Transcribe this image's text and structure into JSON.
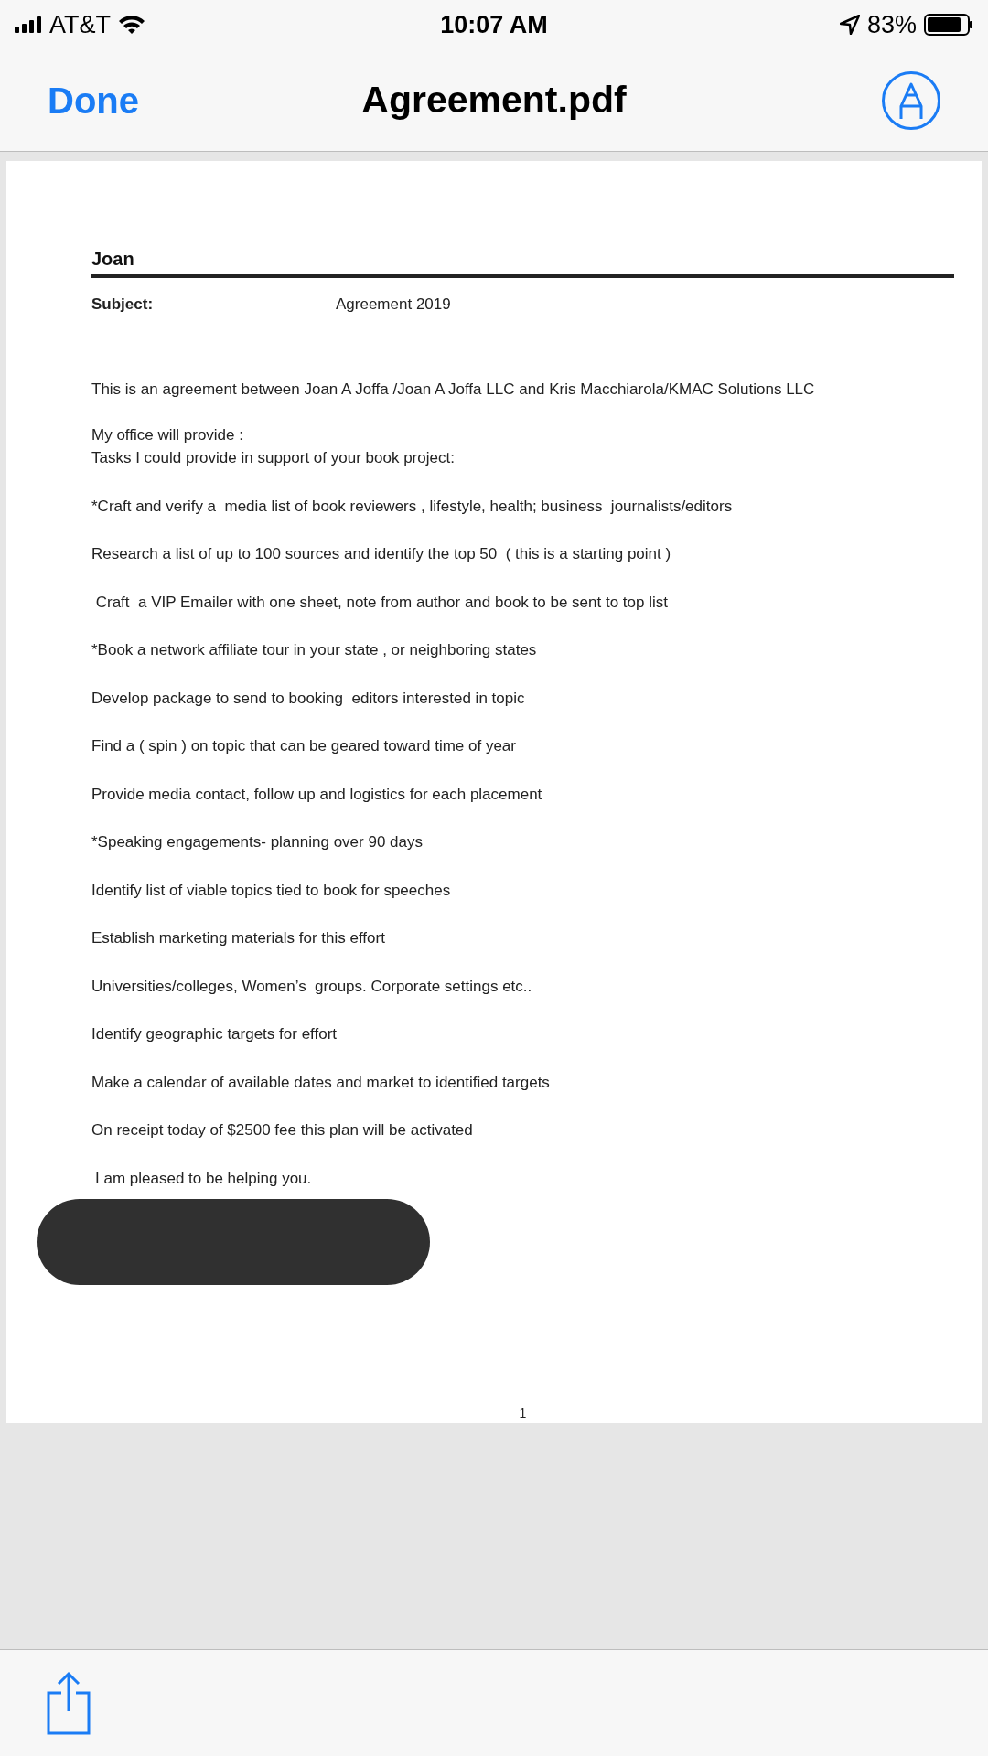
{
  "status_bar": {
    "carrier": "AT&T",
    "time": "10:07 AM",
    "battery": "83%"
  },
  "nav_bar": {
    "done": "Done",
    "title": "Agreement.pdf"
  },
  "document": {
    "header": "Joan",
    "subject_label": "Subject:",
    "subject": "Agreement 2019",
    "intro": "This is an agreement between Joan A Joffa /Joan A Joffa LLC and Kris Macchiarola/KMAC Solutions LLC",
    "provide": [
      "My office will provide :",
      "Tasks I could provide in support of your book project:"
    ],
    "lines": [
      "*Craft and verify a  media list of book reviewers , lifestyle, health; business  journalists/editors",
      "Research a list of up to 100 sources and identify the top 50  ( this is a starting point )",
      " Craft  a VIP Emailer with one sheet, note from author and book to be sent to top list",
      "*Book a network affiliate tour in your state , or neighboring states",
      "Develop package to send to booking  editors interested in topic",
      "Find a ( spin ) on topic that can be geared toward time of year",
      "Provide media contact, follow up and logistics for each placement",
      "*Speaking engagements- planning over 90 days",
      "Identify list of viable topics tied to book for speeches",
      "Establish marketing materials for this effort",
      "Universities/colleges, Women’s  groups. Corporate settings etc..",
      "Identify geographic targets for effort",
      "Make a calendar of available dates and market to identified targets",
      "On receipt today of $2500 fee this plan will be activated"
    ],
    "closing": "I am pleased to be helping you.",
    "page_number": "1"
  }
}
